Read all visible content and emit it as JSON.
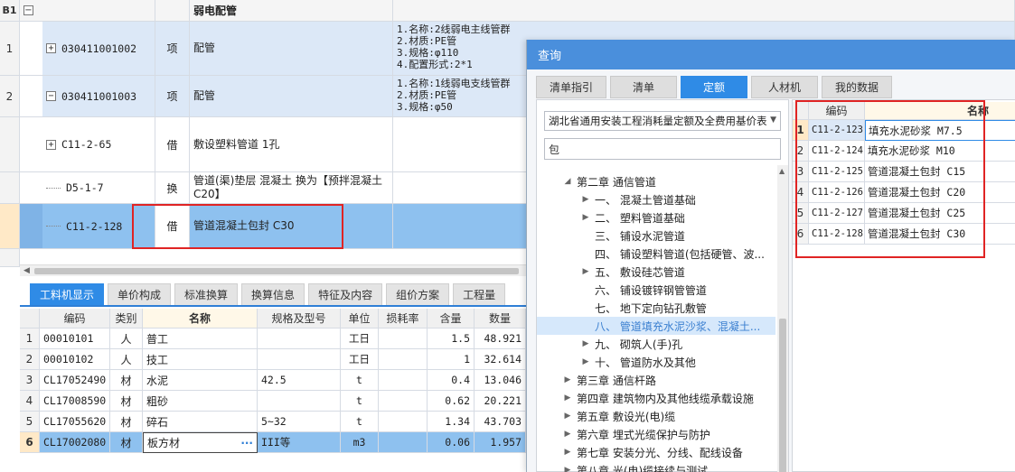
{
  "top_grid": {
    "header_id": "B1",
    "header_title": "弱电配管",
    "rows": [
      {
        "num": "1",
        "code": "030411001002",
        "type": "项",
        "name": "配管",
        "desc": "1.名称:2线弱电主线管群\n2.材质:PE管\n3.规格:φ110\n4.配置形式:2*1"
      },
      {
        "num": "2",
        "code": "030411001003",
        "type": "项",
        "name": "配管",
        "desc": "1.名称:1线弱电支线管群\n2.材质:PE管\n3.规格:φ50"
      },
      {
        "num": "",
        "code": "C11-2-65",
        "type": "借",
        "name": "敷设塑料管道 1孔",
        "desc": ""
      },
      {
        "num": "",
        "code": "D5-1-7",
        "type": "换",
        "name": "管道(渠)垫层 混凝土  换为【预拌混凝土 C20】",
        "desc": ""
      },
      {
        "num": "",
        "code": "C11-2-128",
        "type": "借",
        "name": "管道混凝土包封 C30",
        "desc": ""
      }
    ]
  },
  "bottom_tabs": [
    "工料机显示",
    "单价构成",
    "标准换算",
    "换算信息",
    "特征及内容",
    "组价方案",
    "工程量"
  ],
  "material_grid": {
    "columns": [
      "编码",
      "类别",
      "名称",
      "规格及型号",
      "单位",
      "损耗率",
      "含量",
      "数量"
    ],
    "rows": [
      {
        "num": "1",
        "code": "00010101",
        "cat": "人",
        "name": "普工",
        "spec": "",
        "unit": "工日",
        "loss": "",
        "qty": "1.5",
        "amount": "48.921"
      },
      {
        "num": "2",
        "code": "00010102",
        "cat": "人",
        "name": "技工",
        "spec": "",
        "unit": "工日",
        "loss": "",
        "qty": "1",
        "amount": "32.614"
      },
      {
        "num": "3",
        "code": "CL17052490",
        "cat": "材",
        "name": "水泥",
        "spec": "42.5",
        "unit": "t",
        "loss": "",
        "qty": "0.4",
        "amount": "13.046"
      },
      {
        "num": "4",
        "code": "CL17008590",
        "cat": "材",
        "name": "粗砂",
        "spec": "",
        "unit": "t",
        "loss": "",
        "qty": "0.62",
        "amount": "20.221"
      },
      {
        "num": "5",
        "code": "CL17055620",
        "cat": "材",
        "name": "碎石",
        "spec": "5~32",
        "unit": "t",
        "loss": "",
        "qty": "1.34",
        "amount": "43.703"
      },
      {
        "num": "6",
        "code": "CL17002080",
        "cat": "材",
        "name": "板方材",
        "spec": "III等",
        "unit": "m3",
        "loss": "",
        "qty": "0.06",
        "amount": "1.957"
      }
    ],
    "more_button": "···"
  },
  "dialog": {
    "title": "查询",
    "tabs": [
      "清单指引",
      "清单",
      "定额",
      "人材机",
      "我的数据"
    ],
    "active_tab": 2,
    "library": "湖北省通用安装工程消耗量定额及全费用基价表",
    "search_value": "包",
    "tree": [
      {
        "label": "第二章 通信管道",
        "level": 1,
        "arrow": "▲"
      },
      {
        "label": "一、 混凝土管道基础",
        "level": 2,
        "arrow": "▶"
      },
      {
        "label": "二、 塑料管道基础",
        "level": 2,
        "arrow": "▶"
      },
      {
        "label": "三、 铺设水泥管道",
        "level": 2,
        "arrow": ""
      },
      {
        "label": "四、 铺设塑料管道(包括硬管、波...",
        "level": 2,
        "arrow": ""
      },
      {
        "label": "五、 敷设硅芯管道",
        "level": 2,
        "arrow": "▶"
      },
      {
        "label": "六、 铺设镀锌钢管管道",
        "level": 2,
        "arrow": ""
      },
      {
        "label": "七、 地下定向钻孔敷管",
        "level": 2,
        "arrow": ""
      },
      {
        "label": "八、 管道填充水泥沙浆、混凝土...",
        "level": 2,
        "arrow": ""
      },
      {
        "label": "九、 砌筑人(手)孔",
        "level": 2,
        "arrow": "▶"
      },
      {
        "label": "十、 管道防水及其他",
        "level": 2,
        "arrow": "▶"
      },
      {
        "label": "第三章 通信杆路",
        "level": 1,
        "arrow": "▶"
      },
      {
        "label": "第四章 建筑物内及其他线缆承载设施",
        "level": 1,
        "arrow": "▶"
      },
      {
        "label": "第五章 敷设光(电)缆",
        "level": 1,
        "arrow": "▶"
      },
      {
        "label": "第六章 埋式光缆保护与防护",
        "level": 1,
        "arrow": "▶"
      },
      {
        "label": "第七章 安装分光、分线、配线设备",
        "level": 1,
        "arrow": "▶"
      },
      {
        "label": "第八章 光(电)缆接续与测试",
        "level": 1,
        "arrow": "▶"
      }
    ],
    "highlighted_tree_index": 8,
    "results": {
      "columns": [
        "编码",
        "名称"
      ],
      "rows": [
        {
          "num": "1",
          "code": "C11-2-123",
          "name": "填充水泥砂浆 M7.5"
        },
        {
          "num": "2",
          "code": "C11-2-124",
          "name": "填充水泥砂浆 M10"
        },
        {
          "num": "3",
          "code": "C11-2-125",
          "name": "管道混凝土包封 C15"
        },
        {
          "num": "4",
          "code": "C11-2-126",
          "name": "管道混凝土包封 C20"
        },
        {
          "num": "5",
          "code": "C11-2-127",
          "name": "管道混凝土包封 C25"
        },
        {
          "num": "6",
          "code": "C11-2-128",
          "name": "管道混凝土包封 C30"
        }
      ]
    }
  },
  "colors": {
    "accent": "#2f8be6",
    "selected_row": "#8ec1ef",
    "highlight_box": "#e02424",
    "dialog_title": "#4a8fdc"
  }
}
